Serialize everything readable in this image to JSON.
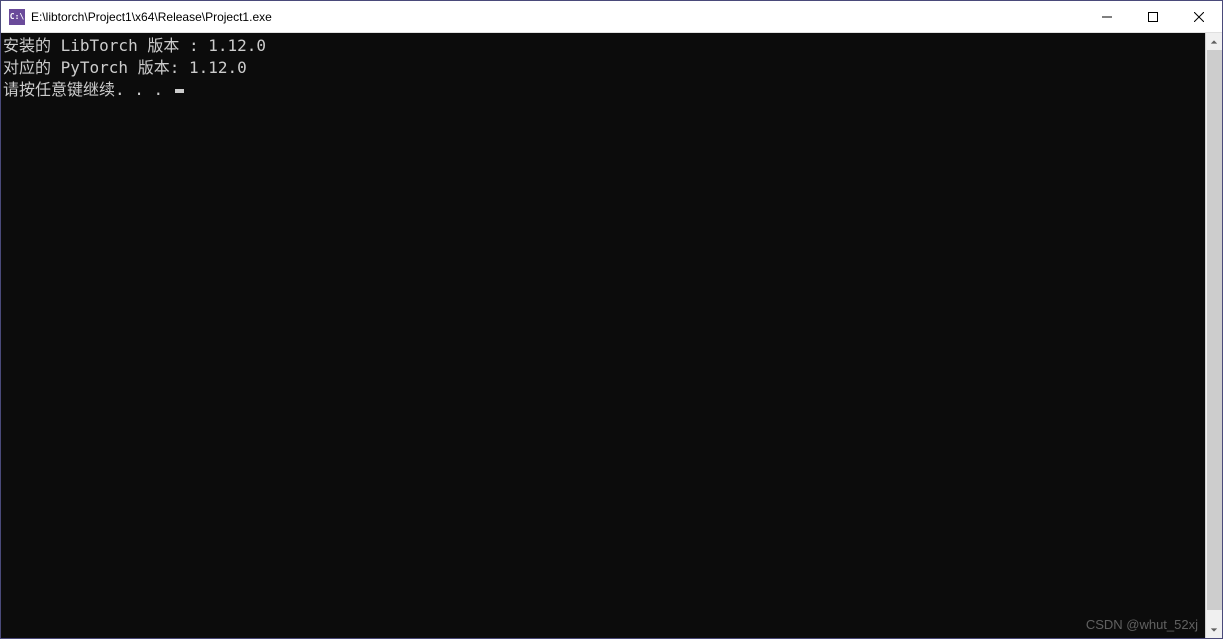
{
  "window": {
    "icon_label": "C:\\",
    "title": "E:\\libtorch\\Project1\\x64\\Release\\Project1.exe"
  },
  "console": {
    "lines": [
      "安装的 LibTorch 版本 : 1.12.0",
      "对应的 PyTorch 版本: 1.12.0",
      "请按任意键继续. . . "
    ]
  },
  "watermark": "CSDN @whut_52xj"
}
